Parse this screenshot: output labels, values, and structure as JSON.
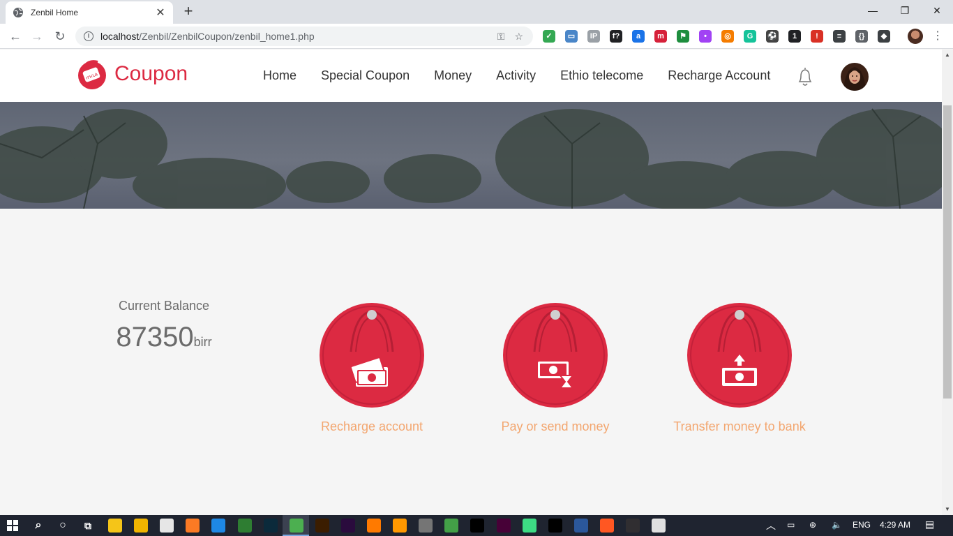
{
  "browser": {
    "tab_title": "Zenbil Home",
    "tab_close": "✕",
    "new_tab": "+",
    "window_controls": {
      "minimize": "—",
      "restore": "❐",
      "close": "✕"
    },
    "nav": {
      "back": "←",
      "forward": "→",
      "reload": "↻"
    },
    "url_host": "localhost",
    "url_path": "/Zenbil/ZenbilCoupon/zenbil_home1.php",
    "key_icon": "⚿",
    "star_icon": "☆",
    "extensions": [
      {
        "name": "shield-ext-icon",
        "color": "#34a853",
        "glyph": "✓"
      },
      {
        "name": "window-ext-icon",
        "color": "#4a86c8",
        "glyph": "▭"
      },
      {
        "name": "ip-ext-icon",
        "color": "#9aa0a6",
        "glyph": "IP"
      },
      {
        "name": "font-ext-icon",
        "color": "#202124",
        "glyph": "f?"
      },
      {
        "name": "a-ext-icon",
        "color": "#1a73e8",
        "glyph": "a"
      },
      {
        "name": "m-ext-icon",
        "color": "#d6213a",
        "glyph": "m"
      },
      {
        "name": "flag-ext-icon",
        "color": "#1e8e3e",
        "glyph": "⚑"
      },
      {
        "name": "purple-ext-icon",
        "color": "#a142f4",
        "glyph": "•"
      },
      {
        "name": "orange-ext-icon",
        "color": "#f57c00",
        "glyph": "◎"
      },
      {
        "name": "grammarly-ext-icon",
        "color": "#15c39a",
        "glyph": "G"
      },
      {
        "name": "soccer-ext-icon",
        "color": "#444444",
        "glyph": "⚽"
      },
      {
        "name": "badge-ext-icon",
        "color": "#202124",
        "glyph": "1"
      },
      {
        "name": "red-ext-icon",
        "color": "#d93025",
        "glyph": "!"
      },
      {
        "name": "list-ext-icon",
        "color": "#3c4043",
        "glyph": "≡"
      },
      {
        "name": "braces-ext-icon",
        "color": "#5f6368",
        "glyph": "{}"
      },
      {
        "name": "cube-ext-icon",
        "color": "#3c4043",
        "glyph": "◆"
      }
    ],
    "menu_icon": "⋮"
  },
  "site": {
    "brand": "Coupon",
    "nav": [
      "Home",
      "Special Coupon",
      "Money",
      "Activity",
      "Ethio telecome",
      "Recharge Account"
    ],
    "accent_color": "#dc2a42",
    "label_color": "#f3a66f"
  },
  "balance": {
    "label": "Current Balance",
    "amount": "87350",
    "unit": "birr"
  },
  "actions": [
    {
      "label": "Recharge account",
      "icon": "cash-stack-icon"
    },
    {
      "label": "Pay or send money",
      "icon": "cash-hourglass-icon"
    },
    {
      "label": "Transfer money to bank",
      "icon": "cash-upload-icon"
    }
  ],
  "taskbar": {
    "language": "ENG",
    "time": "4:29 AM"
  }
}
